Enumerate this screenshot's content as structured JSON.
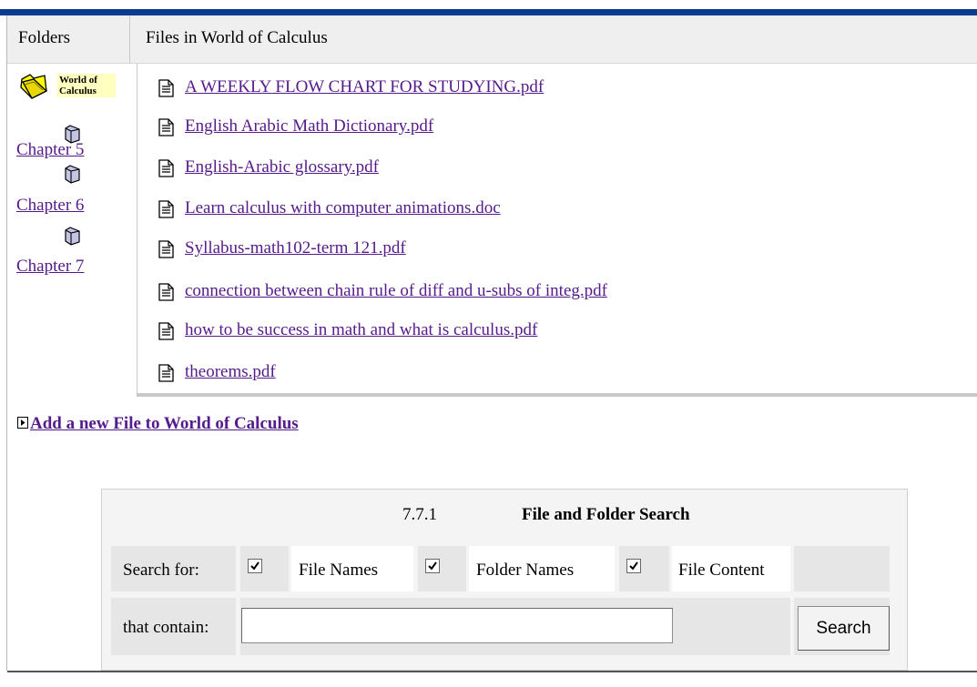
{
  "header": {
    "folders_label": "Folders",
    "files_label": "Files in World of Calculus"
  },
  "folders": {
    "root_label": "World of Calculus",
    "root_icon": "open-folder-icon",
    "items": [
      {
        "label": "Chapter 5",
        "icon": "folder-icon"
      },
      {
        "label": "Chapter 6",
        "icon": "folder-icon"
      },
      {
        "label": "Chapter 7",
        "icon": "folder-icon"
      }
    ]
  },
  "files": [
    {
      "name": "A WEEKLY FLOW CHART FOR STUDYING.pdf",
      "icon": "document-icon"
    },
    {
      "name": "English Arabic Math Dictionary.pdf",
      "icon": "document-icon"
    },
    {
      "name": "English-Arabic glossary.pdf",
      "icon": "document-icon"
    },
    {
      "name": "Learn calculus with computer animations.doc",
      "icon": "document-icon"
    },
    {
      "name": "Syllabus-math102-term 121.pdf",
      "icon": "document-icon"
    },
    {
      "name": "connection between chain rule of diff and u-subs of integ.pdf",
      "icon": "document-icon"
    },
    {
      "name": "how to be success in math and what is calculus.pdf",
      "icon": "document-icon"
    },
    {
      "name": "theorems.pdf",
      "icon": "document-icon"
    }
  ],
  "add_file": {
    "label": "Add a new File to World of Calculus",
    "icon": "arrow-right-icon"
  },
  "search": {
    "version": "7.7.1",
    "title": "File and Folder Search",
    "search_for_label": "Search for:",
    "options": [
      {
        "label": "File Names",
        "checked": true
      },
      {
        "label": "Folder Names",
        "checked": true
      },
      {
        "label": "File Content",
        "checked": true
      }
    ],
    "contain_label": "that contain:",
    "query_value": "",
    "button_label": "Search"
  },
  "colors": {
    "top_bar": "#0b3a8f",
    "link": "#551a8b",
    "highlight": "#ffffc0"
  }
}
